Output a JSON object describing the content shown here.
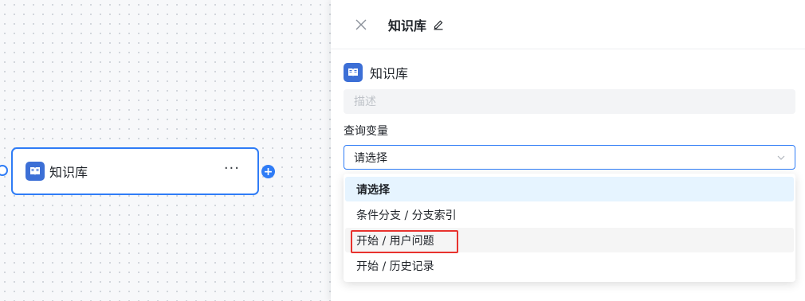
{
  "canvas": {
    "node": {
      "title": "知识库",
      "more_label": "···",
      "add_label": "+"
    }
  },
  "panel": {
    "title": "知识库",
    "section_title": "知识库",
    "description_placeholder": "描述",
    "query_variable_label": "查询变量",
    "select": {
      "value": "请选择"
    },
    "options": [
      {
        "label": "请选择",
        "state": "selected"
      },
      {
        "label": "条件分支 / 分支索引",
        "state": "normal"
      },
      {
        "label": "开始 / 用户问题",
        "state": "hover-highlighted"
      },
      {
        "label": "开始 / 历史记录",
        "state": "normal"
      }
    ]
  },
  "colors": {
    "accent": "#2f7cf6",
    "icon_bg": "#3c6fd6",
    "highlight": "#e8322e",
    "selected_bg": "#e6f4ff"
  },
  "icons": [
    "book-icon",
    "close-icon",
    "edit-icon",
    "chevron-down-icon",
    "more-icon",
    "plus-icon"
  ]
}
